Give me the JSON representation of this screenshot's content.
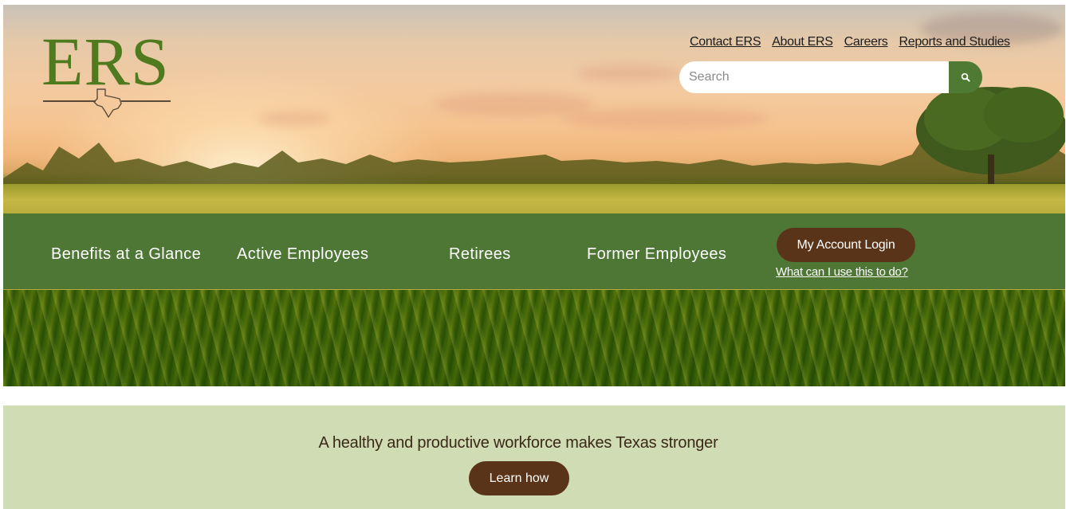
{
  "logo": {
    "text": "ERS"
  },
  "header": {
    "links": [
      {
        "label": "Contact ERS"
      },
      {
        "label": "About ERS"
      },
      {
        "label": "Careers"
      },
      {
        "label": "Reports and Studies"
      }
    ],
    "search": {
      "placeholder": "Search",
      "value": ""
    }
  },
  "nav": {
    "items": [
      {
        "label": "Benefits at a Glance"
      },
      {
        "label": "Active Employees"
      },
      {
        "label": "Retirees"
      },
      {
        "label": "Former Employees"
      }
    ],
    "login_label": "My Account Login",
    "login_help": "What can I use this to do?"
  },
  "banner": {
    "tagline": "A healthy and productive workforce makes Texas stronger",
    "cta_label": "Learn how"
  },
  "colors": {
    "nav_green": "#4e7635",
    "brown_button": "#5a3418",
    "banner_bg": "#d0ddb4",
    "logo_green": "#4f7a1e"
  }
}
